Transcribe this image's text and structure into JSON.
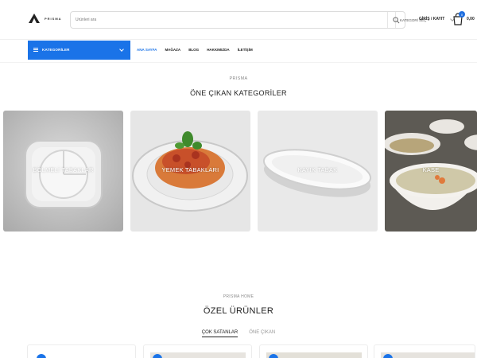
{
  "header": {
    "logo_text": "PRISMA",
    "search_placeholder": "Ürünleri ara",
    "category_select": "KATEGORİ SEÇ",
    "login": "GİRİŞ / KAYIT",
    "cart_count": "0",
    "cart_total": "0,00"
  },
  "nav": {
    "categories_button": "KATEGORİLER",
    "items": [
      "ANA SAYFA",
      "MAĞAZA",
      "BLOG",
      "HAKKIMIZDA",
      "İLETİŞİM"
    ]
  },
  "featured": {
    "eyebrow": "PRISMA",
    "title": "ÖNE ÇIKAN KATEGORİLER",
    "cards": [
      {
        "label": "BÖLMELİ TABAKLAR"
      },
      {
        "label": "YEMEK TABAKLARI"
      },
      {
        "label": "KAYIK TABAK"
      },
      {
        "label": "KASE"
      }
    ]
  },
  "products": {
    "eyebrow": "PRISMA HOME",
    "title": "ÖZEL ÜRÜNLER",
    "tabs": [
      {
        "label": "ÇOK SATANLAR",
        "active": true
      },
      {
        "label": "ÖNE ÇIKAN",
        "active": false
      }
    ]
  },
  "colors": {
    "accent": "#1a73e8"
  }
}
